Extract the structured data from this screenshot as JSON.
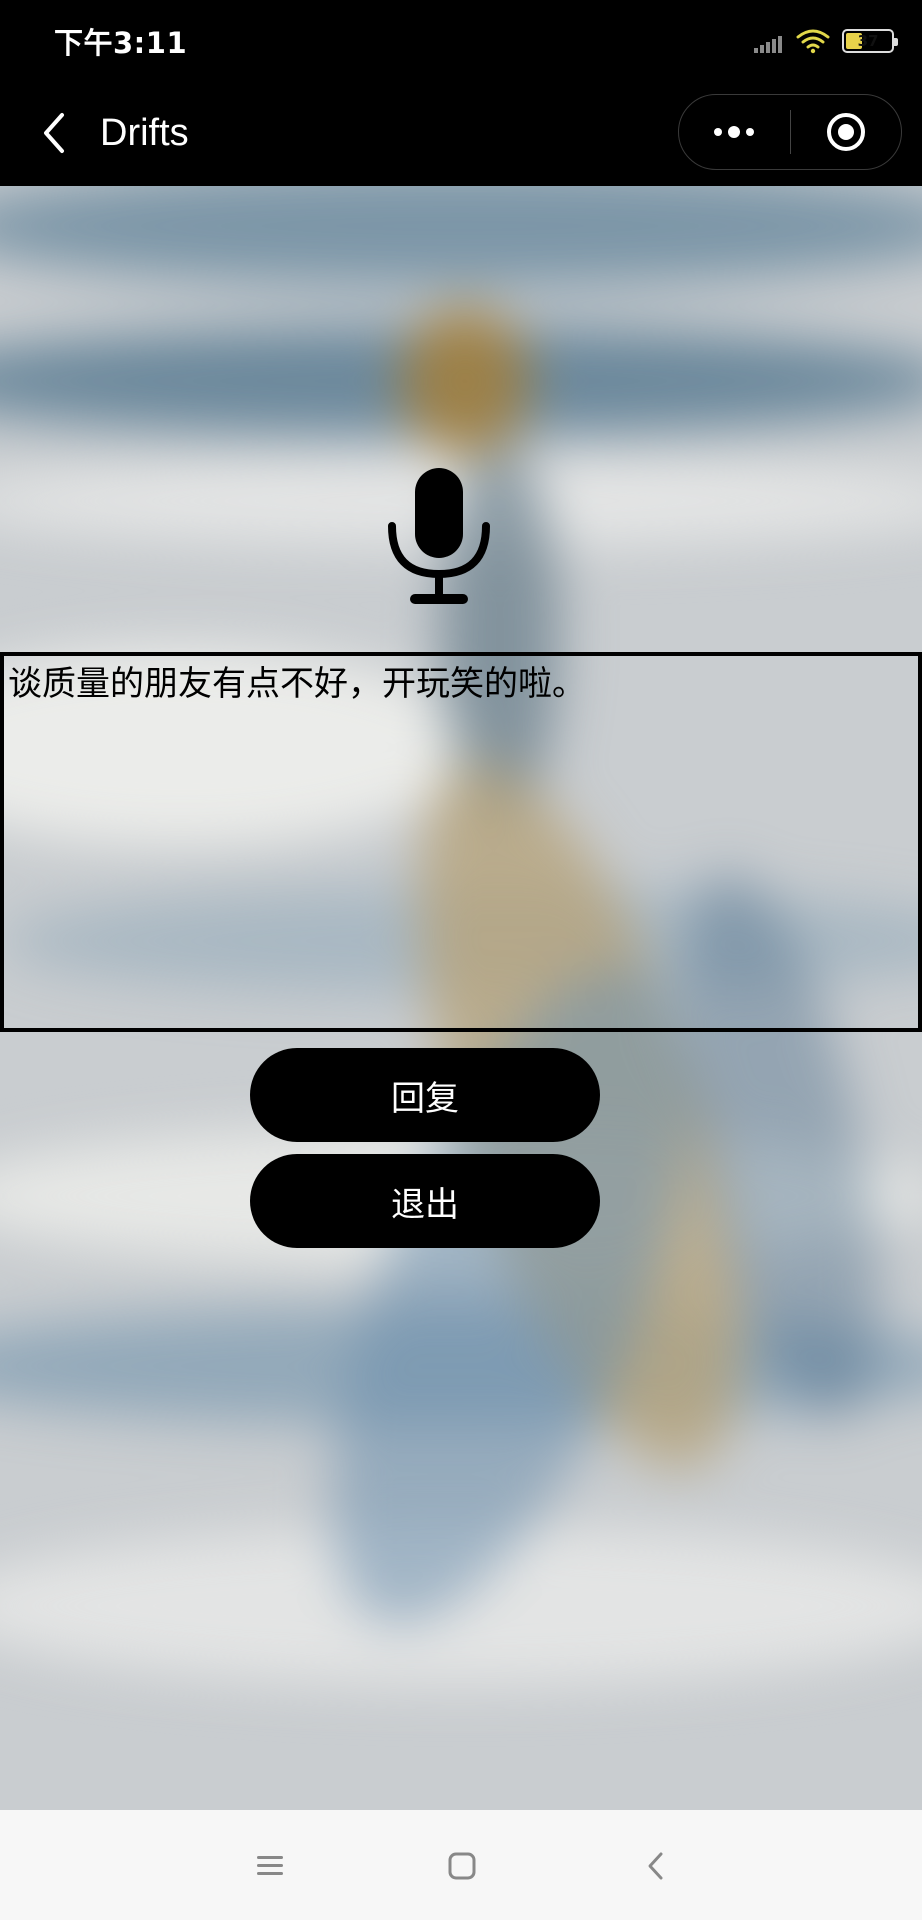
{
  "status_bar": {
    "time": "下午3:11",
    "battery_level": "37",
    "battery_fraction": 0.37,
    "icons": [
      "signal-icon",
      "wifi-icon",
      "battery-icon"
    ]
  },
  "nav": {
    "title": "Drifts",
    "back_icon": "chevron-left-icon",
    "more_icon": "more-dots-icon",
    "close_icon": "target-circle-icon"
  },
  "bottle": {
    "mic_icon": "microphone-icon",
    "message": "谈质量的朋友有点不好，开玩笑的啦。"
  },
  "actions": {
    "reply_label": "回复",
    "exit_label": "退出"
  },
  "system_nav": {
    "icons": [
      "menu-icon",
      "home-icon",
      "back-icon"
    ]
  },
  "colors": {
    "bar_background": "#000000",
    "button_background": "#000000",
    "button_text": "#ffffff",
    "sys_nav_background": "#f7f7f7"
  }
}
